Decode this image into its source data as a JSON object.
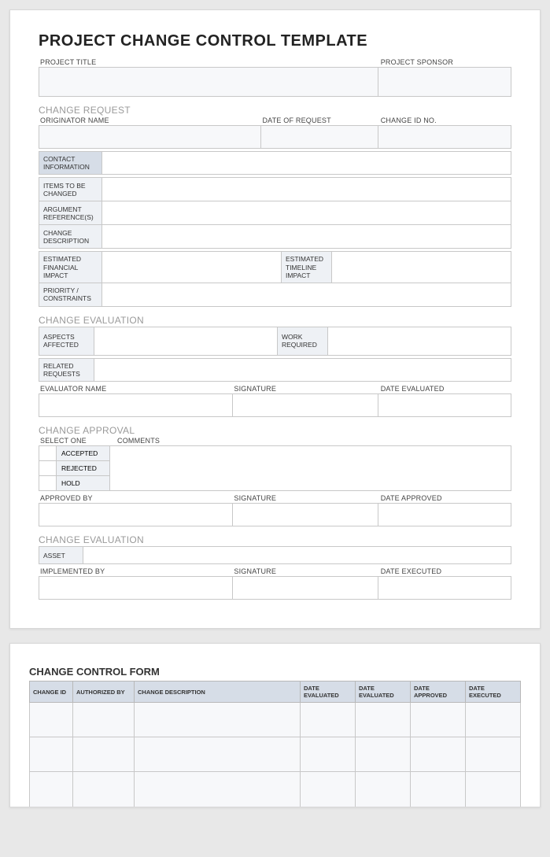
{
  "doc": {
    "title": "PROJECT CHANGE CONTROL TEMPLATE",
    "project_title_label": "PROJECT TITLE",
    "project_sponsor_label": "PROJECT SPONSOR"
  },
  "request": {
    "section": "CHANGE REQUEST",
    "originator_label": "ORIGINATOR NAME",
    "date_label": "DATE OF REQUEST",
    "changeid_label": "CHANGE ID NO.",
    "rows": {
      "contact": "CONTACT INFORMATION",
      "items": "ITEMS TO BE CHANGED",
      "argument": "ARGUMENT REFERENCE(S)",
      "desc": "CHANGE DESCRIPTION",
      "fin": "ESTIMATED FINANCIAL IMPACT",
      "timeline": "ESTIMATED TIMELINE IMPACT",
      "priority": "PRIORITY / CONSTRAINTS"
    }
  },
  "eval": {
    "section": "CHANGE EVALUATION",
    "aspects": "ASPECTS AFFECTED",
    "work": "WORK REQUIRED",
    "related": "RELATED REQUESTS",
    "evaluator_label": "EVALUATOR NAME",
    "signature_label": "SIGNATURE",
    "date_label": "DATE EVALUATED"
  },
  "approval": {
    "section": "CHANGE APPROVAL",
    "select_label": "SELECT ONE",
    "comments_label": "COMMENTS",
    "accepted": "ACCEPTED",
    "rejected": "REJECTED",
    "hold": "HOLD",
    "approvedby_label": "APPROVED BY",
    "signature_label": "SIGNATURE",
    "date_label": "DATE APPROVED"
  },
  "impl": {
    "section": "CHANGE EVALUATION",
    "asset": "ASSET",
    "implby_label": "IMPLEMENTED BY",
    "signature_label": "SIGNATURE",
    "date_label": "DATE EXECUTED"
  },
  "form2": {
    "title": "CHANGE CONTROL FORM",
    "cols": {
      "id": "CHANGE ID",
      "auth": "AUTHORIZED BY",
      "desc": "CHANGE DESCRIPTION",
      "deval1": "DATE EVALUATED",
      "deval2": "DATE EVALUATED",
      "dappr": "DATE APPROVED",
      "dexec": "DATE EXECUTED"
    }
  }
}
